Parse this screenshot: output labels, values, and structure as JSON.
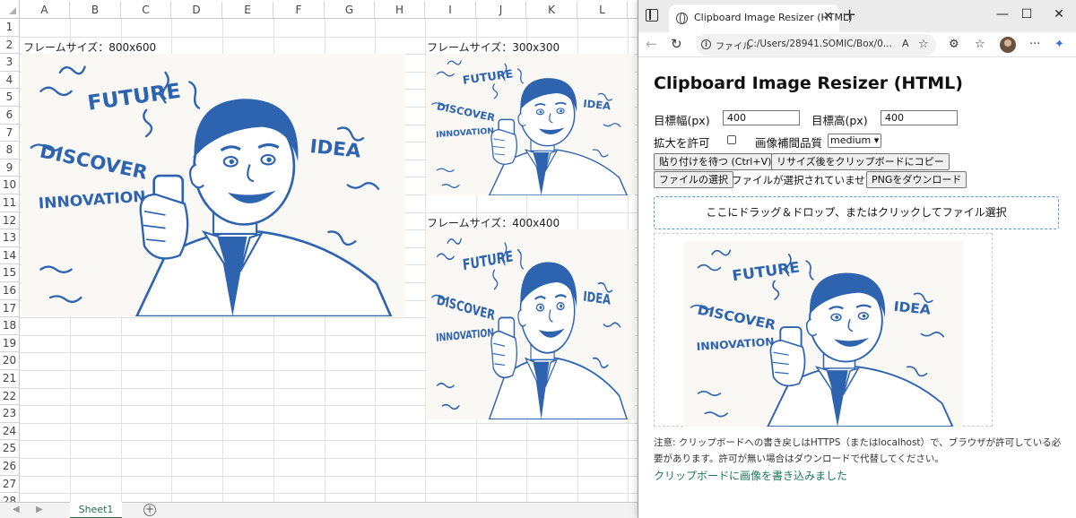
{
  "excel": {
    "columns": [
      "A",
      "B",
      "C",
      "D",
      "E",
      "F",
      "G",
      "H",
      "I",
      "J",
      "K",
      "L"
    ],
    "rows": [
      "1",
      "2",
      "3",
      "4",
      "5",
      "6",
      "7",
      "8",
      "9",
      "10",
      "11",
      "12",
      "13",
      "14",
      "15",
      "16",
      "17",
      "18",
      "19",
      "20",
      "21",
      "22",
      "23",
      "24",
      "25",
      "26",
      "27",
      "28"
    ],
    "labels": {
      "frame800": "フレームサイズ：800x600",
      "frame300": "フレームサイズ：300x300",
      "frame400": "フレームサイズ：400x400"
    },
    "sheet_tab": "Sheet1",
    "add_sheet": "+",
    "nav_prev": "◀",
    "nav_next": "▶"
  },
  "illustration": {
    "words": [
      "FUTURE",
      "DISCOVER",
      "IDEA",
      "INNOVATION"
    ],
    "ink_color": "#2e63b0"
  },
  "browser": {
    "tab_title": "Clipboard Image Resizer (HTML)",
    "tab_close": "✕",
    "new_tab": "+",
    "minimize": "—",
    "maximize": "☐",
    "close": "✕",
    "back": "←",
    "refresh": "↻",
    "url_scheme": "ファイル",
    "url": "C:/Users/28941.SOMIC/Box/0...",
    "read_aloud": "A",
    "favorite": "☆",
    "extensions": "⚙",
    "favorites_list": "☆",
    "more": "···",
    "copilot": "✦"
  },
  "app": {
    "title": "Clipboard Image Resizer (HTML)",
    "width_label": "目標幅(px)",
    "width_value": "400",
    "height_label": "目標高(px)",
    "height_value": "400",
    "allow_upscale_label": "拡大を許可",
    "quality_label": "画像補間品質",
    "quality_value": "medium",
    "paste_button": "貼り付けを待つ (Ctrl+V)",
    "copy_button": "リサイズ後をクリップボードにコピー",
    "choose_file_button": "ファイルの選択",
    "no_file_text": "ファイルが選択されていません",
    "download_button": "PNGをダウンロード",
    "dropzone_text": "ここにドラッグ＆ドロップ、またはクリックしてファイル選択",
    "note": "注意: クリップボードへの書き戻しはHTTPS（またはlocalhost）で、ブラウザが許可している必要があります。許可が無い場合はダウンロードで代替してください。",
    "status": "クリップボードに画像を書き込みました"
  }
}
